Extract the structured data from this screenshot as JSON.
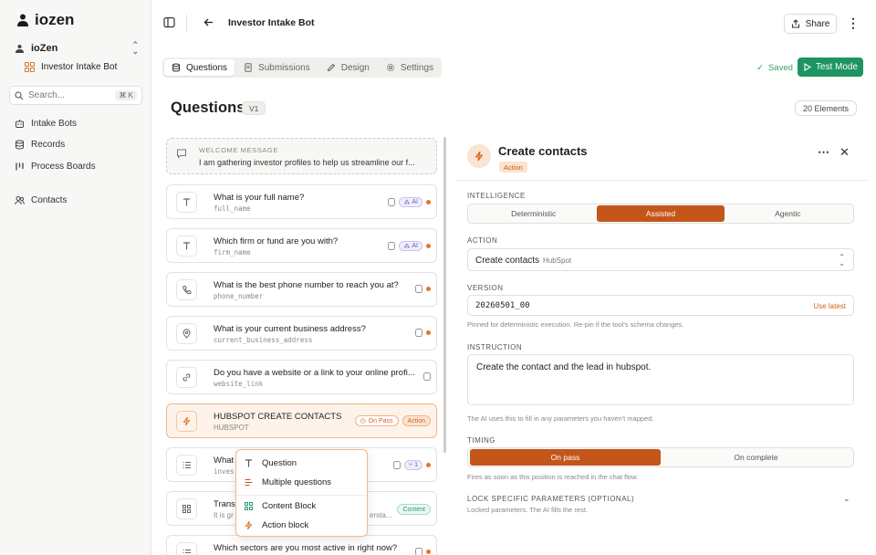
{
  "app": {
    "name": "iozen"
  },
  "sidebar": {
    "workspace": "ioZen",
    "active_bot": "Investor Intake Bot",
    "search_placeholder": "Search...",
    "search_shortcut": "⌘ K",
    "items": [
      {
        "label": "Intake Bots",
        "icon": "bot-icon"
      },
      {
        "label": "Records",
        "icon": "database-icon"
      },
      {
        "label": "Process Boards",
        "icon": "columns-icon"
      },
      {
        "label": "Contacts",
        "icon": "users-icon"
      }
    ]
  },
  "header": {
    "title": "Investor Intake Bot",
    "share_label": "Share"
  },
  "tabs": [
    {
      "label": "Questions",
      "active": true
    },
    {
      "label": "Submissions",
      "active": false
    },
    {
      "label": "Design",
      "active": false
    },
    {
      "label": "Settings",
      "active": false
    }
  ],
  "status": {
    "saved_label": "Saved",
    "test_mode_label": "Test Mode"
  },
  "questions": {
    "title": "Questions",
    "version": "V1",
    "element_count": "20 Elements",
    "welcome": {
      "label": "WELCOME MESSAGE",
      "text": "I am gathering investor profiles to help us streamline our f..."
    },
    "items": [
      {
        "title": "What is your full name?",
        "field": "full_name",
        "icon": "text-icon",
        "ai": "AI"
      },
      {
        "title": "Which firm or fund are you with?",
        "field": "firm_name",
        "icon": "text-icon",
        "ai": "AI"
      },
      {
        "title": "What is the best phone number to reach you at?",
        "field": "phone_number",
        "icon": "phone-icon"
      },
      {
        "title": "What is your current business address?",
        "field": "current_business_address",
        "icon": "location-icon"
      },
      {
        "title": "Do you have a website or a link to your online profi...",
        "field": "website_link",
        "icon": "link-icon"
      },
      {
        "title": "HUBSPOT CREATE CONTACTS",
        "field": "HUBSPOT",
        "icon": "bolt-icon",
        "pill1": "On Pass",
        "pill2": "Action"
      },
      {
        "title": "What",
        "field": "inves",
        "icon": "list-icon",
        "ai": "1"
      },
      {
        "title": "Trans",
        "field": "It is gr",
        "field_tail": "ersta...",
        "icon": "grid-icon",
        "pill": "Content"
      },
      {
        "title": "Which sectors are you most active in right now?",
        "field": "",
        "icon": "list-icon"
      }
    ]
  },
  "add_menu": {
    "items": [
      "Question",
      "Multiple questions",
      "Content Block",
      "Action block"
    ]
  },
  "panel": {
    "title": "Create contacts",
    "badge": "Action",
    "intelligence_label": "INTELLIGENCE",
    "intelligence_options": [
      "Deterministic",
      "Assisted",
      "Agentic"
    ],
    "intelligence_selected": "Assisted",
    "action_label": "ACTION",
    "action_value": "Create contacts",
    "action_provider": "HubSpot",
    "version_label": "VERSION",
    "version_value": "20260501_00",
    "use_latest": "Use latest",
    "version_help": "Pinned for deterministic execution. Re-pin if the tool's schema changes.",
    "instruction_label": "INSTRUCTION",
    "instruction_value": "Create the contact and the lead in hubspot.",
    "instruction_help": "The AI uses this to fill in any parameters you haven't mapped.",
    "timing_label": "TIMING",
    "timing_options": [
      "On pass",
      "On complete"
    ],
    "timing_selected": "On pass",
    "timing_help": "Fires as soon as this position is reached in the chat flow.",
    "lock_label": "LOCK SPECIFIC PARAMETERS (OPTIONAL)",
    "lock_help": "Locked parameters. The AI fills the rest."
  },
  "colors": {
    "accent": "#c4561a",
    "success": "#1e9462",
    "ai": "#6656c4"
  }
}
